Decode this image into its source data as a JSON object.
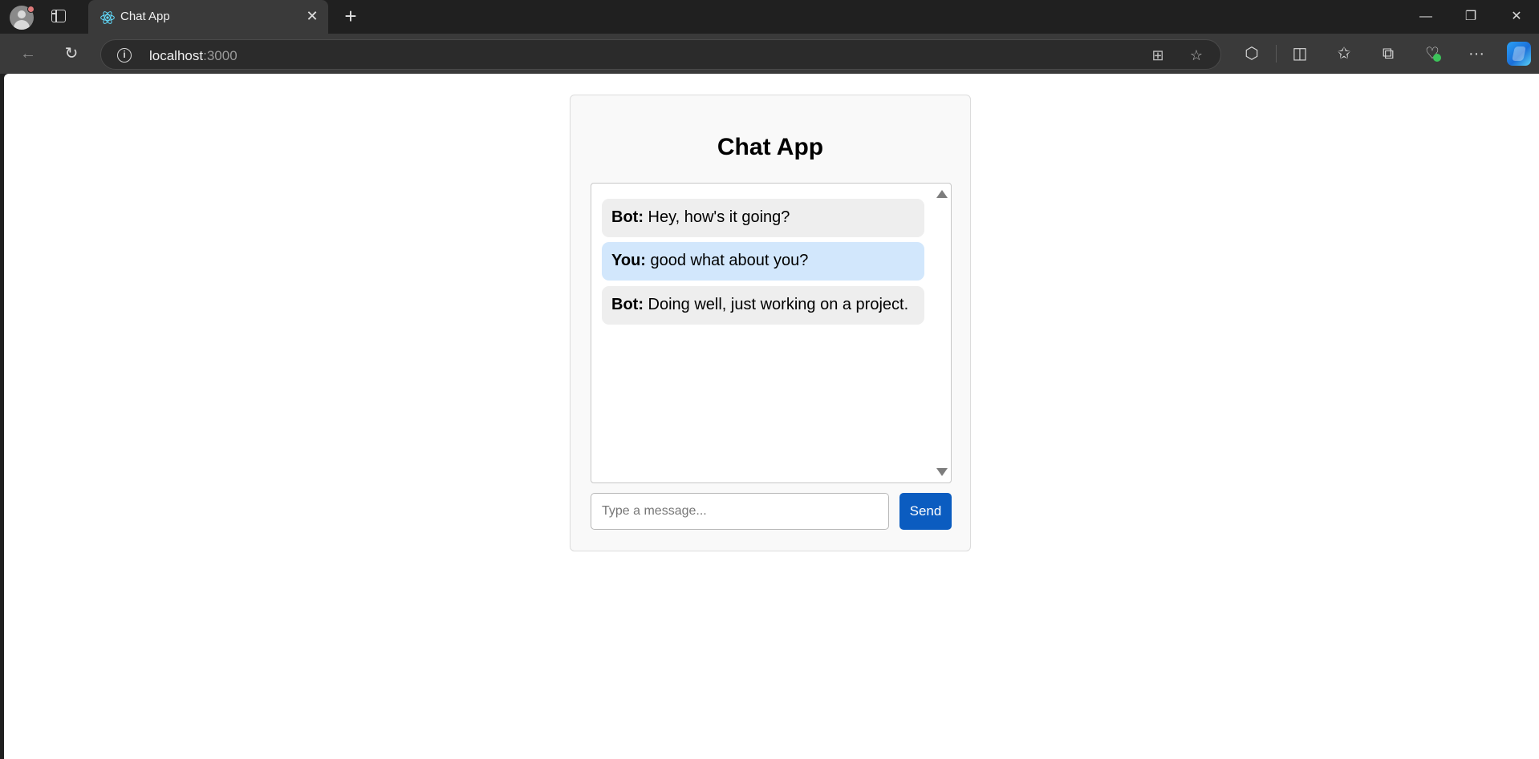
{
  "browser": {
    "tab_title": "Chat App",
    "tab_close": "✕",
    "new_tab": "+",
    "url_host": "localhost",
    "url_port": ":3000",
    "window": {
      "minimize": "—",
      "restore": "❐",
      "close": "✕"
    },
    "icons": {
      "profile": "profile-avatar-icon",
      "tab_actions": "tab-actions-icon",
      "react": "react-logo-icon",
      "back": "←",
      "reload": "↻",
      "info": "i",
      "apps": "⊞",
      "favorite": "☆",
      "extensions": "⬡",
      "split_screen": "◫",
      "favorites": "✩",
      "collections": "⧉",
      "browser_essentials": "♡",
      "more": "···",
      "copilot": "copilot-icon"
    }
  },
  "chat": {
    "title": "Chat App",
    "messages": [
      {
        "sender": "Bot:",
        "text": " Hey, how's it going?",
        "role": "bot"
      },
      {
        "sender": "You:",
        "text": " good what about you?",
        "role": "user"
      },
      {
        "sender": "Bot:",
        "text": " Doing well, just working on a project.",
        "role": "bot"
      }
    ],
    "input_placeholder": "Type a message...",
    "input_value": "",
    "send_label": "Send",
    "colors": {
      "send_button": "#0b5cc0",
      "user_bubble": "#d2e7fc",
      "bot_bubble": "#eeeeee"
    }
  }
}
